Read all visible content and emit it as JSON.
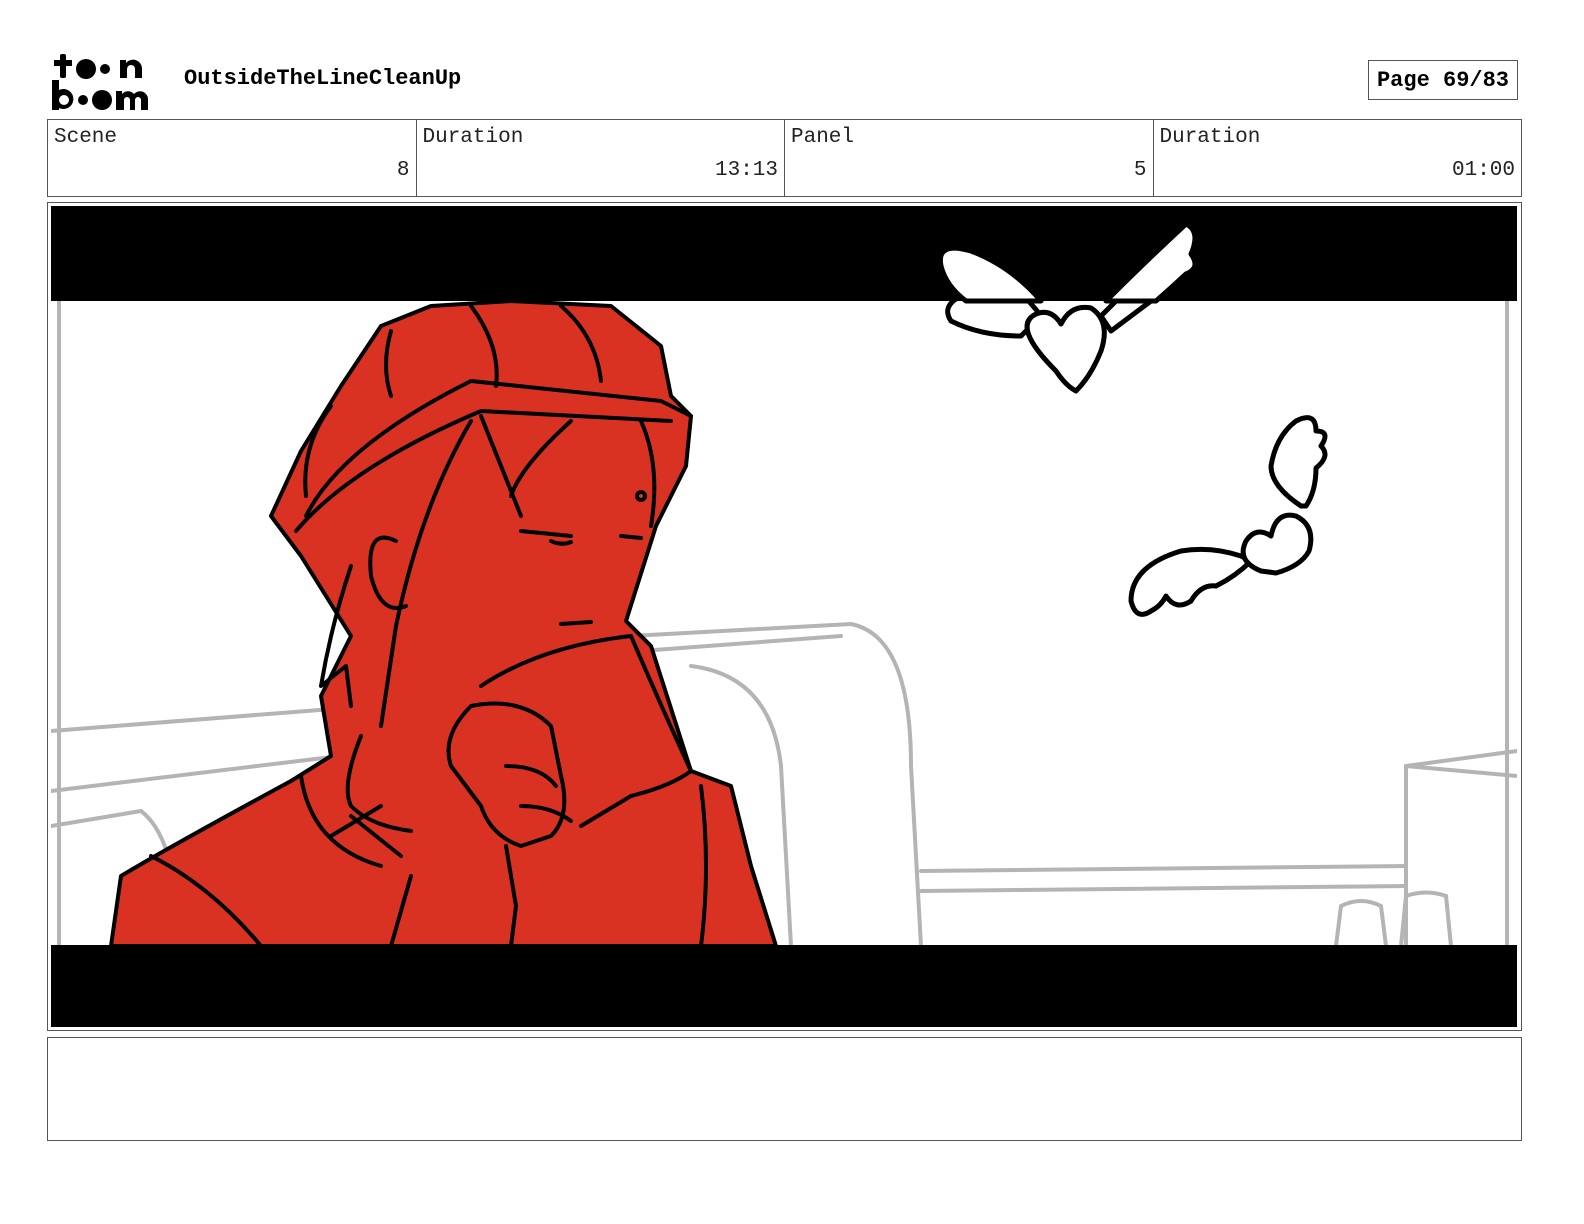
{
  "header": {
    "logo_text": "toon boom",
    "project_title": "OutsideTheLineCleanUp",
    "page_label": "Page 69/83"
  },
  "info": {
    "scene_label": "Scene",
    "scene_value": "8",
    "scene_duration_label": "Duration",
    "scene_duration_value": "13:13",
    "panel_label": "Panel",
    "panel_value": "5",
    "panel_duration_label": "Duration",
    "panel_duration_value": "01:00"
  },
  "panel": {
    "art_description_colors": {
      "character_fill": "#d93223",
      "background_lines": "#b4b4b4",
      "letterbox": "#000000"
    },
    "icons": [
      "winged-heart-icon",
      "winged-heart-icon"
    ]
  },
  "notes": {
    "text": ""
  }
}
